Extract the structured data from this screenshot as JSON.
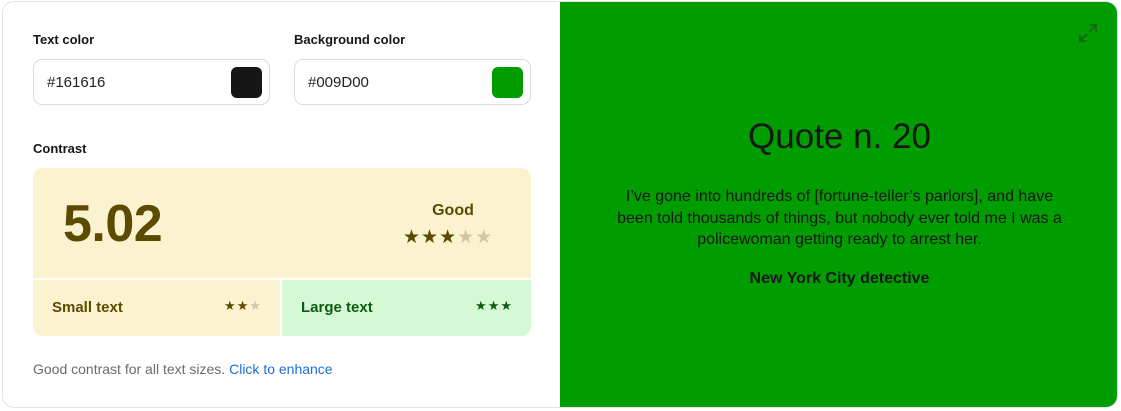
{
  "text_color": {
    "label": "Text color",
    "value": "#161616",
    "swatch": "#161616"
  },
  "background_color": {
    "label": "Background color",
    "value": "#009D00",
    "swatch": "#009D00"
  },
  "contrast": {
    "label": "Contrast",
    "ratio": "5.02",
    "rating": "Good",
    "rating_stars": 3,
    "max_stars": 5,
    "panel_bg": "#FBF3D0",
    "accent_color": "#5B4A00",
    "small_text": {
      "label": "Small text",
      "stars": 2,
      "max_stars": 3,
      "bg": "#FBF3D0"
    },
    "large_text": {
      "label": "Large text",
      "stars": 3,
      "max_stars": 3,
      "bg": "#D5F9D5",
      "accent": "#0E5C0E"
    }
  },
  "status": {
    "message": "Good contrast for all text sizes.",
    "link": "Click to enhance"
  },
  "preview": {
    "title": "Quote n. 20",
    "quote": "I’ve gone into hundreds of [fortune-teller’s parlors], and have been told thousands of things, but nobody ever told me I was a policewoman getting ready to arrest her.",
    "author": "New York City detective",
    "expand_icon": "expand-icon"
  }
}
